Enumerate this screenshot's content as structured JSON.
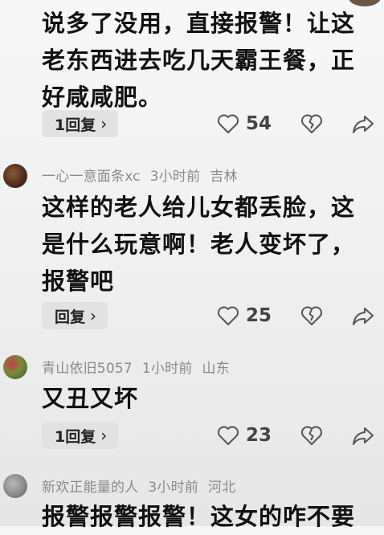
{
  "comments": [
    {
      "username": "",
      "time": "",
      "location": "",
      "text": "说多了没用，直接报警！让这老东西进去吃几天霸王餐，正好咸咸肥。",
      "reply_label": "1回复",
      "likes": "54"
    },
    {
      "username": "一心一意面条xc",
      "time": "3小时前",
      "location": "吉林",
      "text": "这样的老人给儿女都丢脸，这是什么玩意啊！老人变坏了，报警吧",
      "reply_label": "回复",
      "likes": "25"
    },
    {
      "username": "青山依旧5057",
      "time": "1小时前",
      "location": "山东",
      "text": "又丑又坏",
      "reply_label": "1回复",
      "likes": "23"
    },
    {
      "username": "新欢正能量的人",
      "time": "3小时前",
      "location": "河北",
      "text": "报警报警报警！这女的咋不要",
      "reply_label": "",
      "likes": ""
    }
  ],
  "icons": {
    "like": "heart-outline-icon",
    "dislike": "broken-heart-icon",
    "share": "share-arrow-icon",
    "reply_chevron": "chevron-right-icon"
  },
  "colors": {
    "text": "#111111",
    "meta": "#8a8a8a",
    "button_bg": "#e2e2e2",
    "icon": "#555555"
  }
}
